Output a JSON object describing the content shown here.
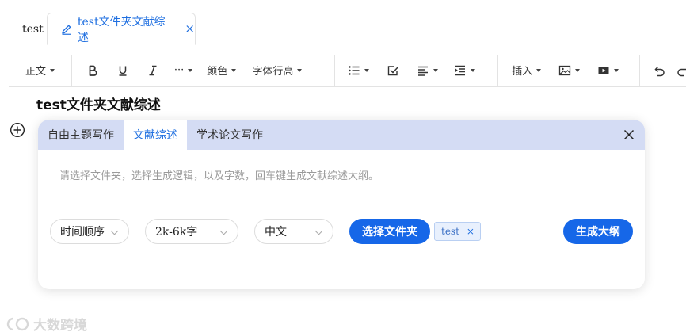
{
  "tabs": {
    "plain_label": "test",
    "active_label": "test文件夹文献综述",
    "active_close": "×"
  },
  "toolbar": {
    "text_style": "正文",
    "more": "···",
    "color": "颜色",
    "line_height": "字体行高",
    "insert": "插入"
  },
  "document": {
    "title": "test文件夹文献综述"
  },
  "panel": {
    "tabs": [
      "自由主题写作",
      "文献综述",
      "学术论文写作"
    ],
    "active_tab": "文献综述",
    "prompt": "请选择文件夹，选择生成逻辑，以及字数，回车键生成文献综述大纲。",
    "order_select": "时间顺序",
    "length_select": "2k-6k字",
    "language_select": "中文",
    "choose_folder_button": "选择文件夹",
    "folder_chip": "test",
    "folder_chip_remove": "×",
    "generate_button": "生成大纲"
  },
  "watermark": {
    "text": "大数跨境"
  },
  "colors": {
    "accent": "#1667e8",
    "tab_strip": "#d4dcf4",
    "chip_bg": "#e8f0fd"
  }
}
